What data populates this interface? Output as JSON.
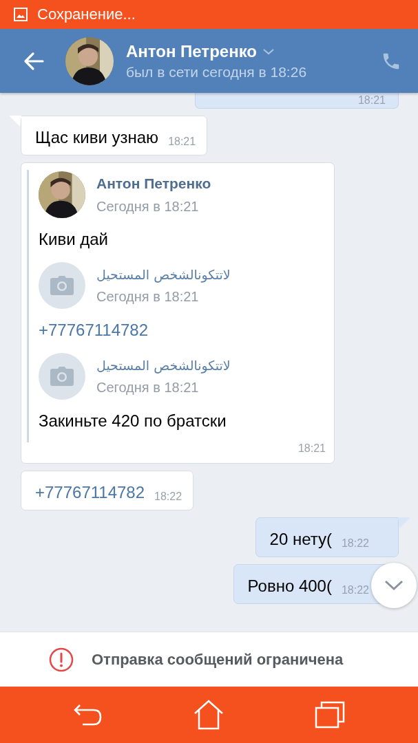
{
  "status_bar": {
    "title": "Сохранение..."
  },
  "header": {
    "name": "Антон Петренко",
    "status": "был в сети сегодня в 18:26"
  },
  "messages": [
    {
      "kind": "partial",
      "outgoing": true,
      "time": "18:21"
    },
    {
      "kind": "text",
      "outgoing": false,
      "tail": true,
      "text": "Щас киви узнаю",
      "time": "18:21"
    },
    {
      "kind": "forward",
      "time": "18:21",
      "forwarded": [
        {
          "sender": "Антон Петренко",
          "date": "Сегодня в 18:21",
          "text": "Киви дай"
        },
        {
          "kind": "camera",
          "sender": "لاتتكونالشخص المستحيل",
          "date": "Сегодня в 18:21",
          "link": "+77767114782"
        },
        {
          "kind": "camera",
          "sender": "لاتتكونالشخص المستحيل",
          "date": "Сегодня в 18:21",
          "text": "Закиньте 420 по братски"
        }
      ]
    },
    {
      "kind": "link",
      "outgoing": false,
      "tail": false,
      "text": "+77767114782",
      "time": "18:22"
    },
    {
      "kind": "text",
      "outgoing": true,
      "tail": true,
      "text": "20 нету(",
      "time": "18:22"
    },
    {
      "kind": "text",
      "outgoing": true,
      "tail": false,
      "text": "Ровно 400(",
      "time": "18:22"
    }
  ],
  "notice": {
    "text": "Отправка сообщений ограничена"
  }
}
